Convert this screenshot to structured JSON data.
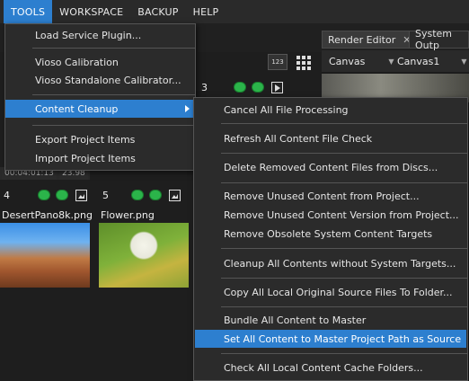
{
  "menubar": {
    "items": [
      {
        "label": "TOOLS",
        "active": true
      },
      {
        "label": "WORKSPACE"
      },
      {
        "label": "BACKUP"
      },
      {
        "label": "HELP"
      }
    ]
  },
  "tabs": {
    "render_editor": "Render Editor",
    "system_output": "System Outp",
    "close_glyph": "✕"
  },
  "toolbar": {
    "canvas_dropdown": "Canvas",
    "canvas1_dropdown": "Canvas1",
    "numeric_button": "123"
  },
  "grid": {
    "cell3_number": "3",
    "cell4_number": "4",
    "cell5_number": "5",
    "cell4_name": "DesertPano8k.png",
    "cell5_name": "Flower.png",
    "time1": "00:04:01:13",
    "time2": "23.98"
  },
  "tools_menu": {
    "items": [
      {
        "label": "Load Service Plugin..."
      },
      {
        "label": "Vioso Calibration"
      },
      {
        "label": "Vioso Standalone Calibrator..."
      },
      {
        "label": "Content Cleanup",
        "highlighted": true,
        "has_submenu": true
      },
      {
        "label": "Export Project Items"
      },
      {
        "label": "Import Project Items"
      }
    ]
  },
  "cleanup_submenu": {
    "items": [
      {
        "label": "Cancel All File Processing"
      },
      {
        "label": "Refresh All Content File Check"
      },
      {
        "label": "Delete Removed Content Files from Discs..."
      },
      {
        "label": "Remove Unused Content from Project..."
      },
      {
        "label": "Remove Unused Content Version from Project..."
      },
      {
        "label": "Remove Obsolete System Content Targets"
      },
      {
        "label": "Cleanup All Contents without System Targets..."
      },
      {
        "label": "Copy All Local Original Source Files To Folder..."
      },
      {
        "label": "Bundle All Content to Master"
      },
      {
        "label": "Set All Content to Master Project Path as Source",
        "highlighted": true
      },
      {
        "label": "Check All Local Content Cache Folders..."
      }
    ]
  },
  "colors": {
    "accent": "#2d7fcf",
    "indicator_green": "#2bb44a"
  }
}
